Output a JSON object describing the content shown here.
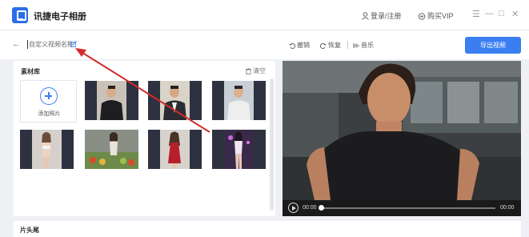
{
  "app": {
    "title": "讯捷电子相册"
  },
  "titlebar": {
    "login_label": "登录/注册",
    "vip_label": "购买VIP",
    "menu_glyph": "☰",
    "minimize_glyph": "—",
    "maximize_glyph": "□",
    "close_glyph": "✕"
  },
  "toolbar": {
    "back_glyph": "←",
    "album_name_placeholder": "自定义视频名称",
    "undo_label": "撤销",
    "redo_label": "恢复",
    "music_label": "音乐",
    "export_label": "导出视频"
  },
  "library": {
    "title": "素材库",
    "clear_label": "清空",
    "add_photo_label": "添加照片",
    "thumbnail_count": 7
  },
  "player": {
    "current_time": "00:00",
    "total_time": "00:00",
    "progress": 0
  },
  "bottom": {
    "label": "片头尾"
  },
  "colors": {
    "accent": "#3b7ef2",
    "annotation_arrow": "#d42a2a",
    "thumbnail_bg": "#2e3140"
  }
}
